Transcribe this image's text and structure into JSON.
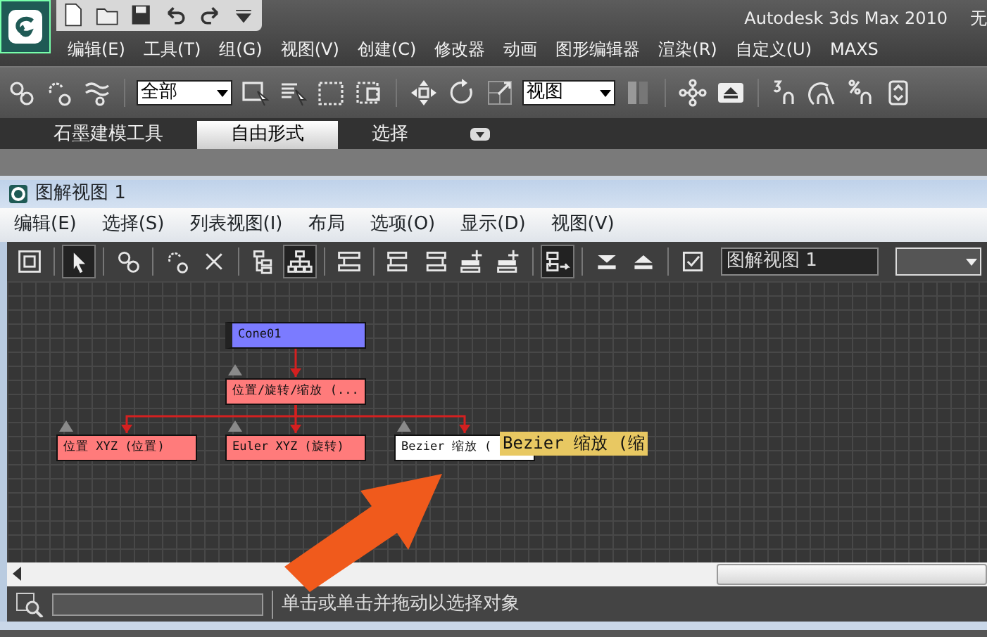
{
  "app_window": {
    "title": "Autodesk 3ds Max  2010",
    "title_suffix": "无",
    "menu": [
      "编辑(E)",
      "工具(T)",
      "组(G)",
      "视图(V)",
      "创建(C)",
      "修改器",
      "动画",
      "图形编辑器",
      "渲染(R)",
      "自定义(U)",
      "MAXS"
    ]
  },
  "main_toolbar": {
    "selection_filter": "全部",
    "reference_coordinate": "视图"
  },
  "ribbon_tabs": [
    {
      "label": "石墨建模工具",
      "selected": false
    },
    {
      "label": "自由形式",
      "selected": true
    },
    {
      "label": "选择",
      "selected": false
    }
  ],
  "schematic_window": {
    "title": "图解视图 1",
    "menu": [
      "编辑(E)",
      "选择(S)",
      "列表视图(I)",
      "布局",
      "选项(O)",
      "显示(D)",
      "视图(V)"
    ],
    "tools": [
      {
        "selected": false
      },
      {
        "selected": true
      },
      {
        "selected": false
      },
      {
        "selected": false
      },
      {
        "selected": false
      },
      {
        "selected": false
      },
      {
        "selected": true
      },
      {
        "selected": false
      },
      {
        "selected": false
      },
      {
        "selected": false
      },
      {
        "selected": false
      },
      {
        "selected": false
      },
      {
        "selected": true
      },
      {
        "selected": false
      },
      {
        "selected": false
      },
      {
        "selected": false
      }
    ],
    "view_name": "图解视图 1",
    "nodes": [
      {
        "label": "Cone01",
        "color": "#7b7bff",
        "children": [
          {
            "label": "位置/旋转/缩放 (...",
            "color": "#ff7b7b",
            "children": [
              {
                "label": "位置 XYZ (位置)",
                "color": "#ff7b7b"
              },
              {
                "label": "Euler XYZ (旋转)",
                "color": "#ff7b7b"
              },
              {
                "label": "Bezier 缩放 (",
                "color": "#ffffff"
              }
            ]
          }
        ]
      }
    ],
    "tooltip": "Bezier 缩放 (缩",
    "status": "单击或单击并拖动以选择对象"
  }
}
